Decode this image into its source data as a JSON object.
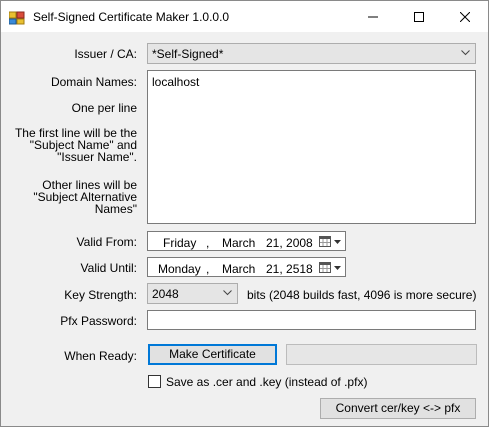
{
  "window": {
    "title": "Self-Signed Certificate Maker 1.0.0.0",
    "icon": "certificate-app-icon",
    "controls": [
      "minimize-icon",
      "maximize-icon",
      "close-icon"
    ]
  },
  "issuer": {
    "label": "Issuer / CA:",
    "value": "*Self-Signed*"
  },
  "domains": {
    "label": "Domain Names:",
    "value": "localhost",
    "note1": "One per line",
    "note2": "The first line will be the \"Subject Name\" and \"Issuer Name\".",
    "note3": "Other lines will be \"Subject Alternative Names\""
  },
  "valid_from": {
    "label": "Valid From:",
    "weekday": "Friday",
    "sep": ",",
    "month": "March",
    "day_year": "21, 2008"
  },
  "valid_until": {
    "label": "Valid Until:",
    "weekday": "Monday",
    "sep": ",",
    "month": "March",
    "day_year": "21, 2518"
  },
  "key_strength": {
    "label": "Key Strength:",
    "value": "2048",
    "hint": "bits (2048 builds fast, 4096 is more secure)"
  },
  "pfx_password": {
    "label": "Pfx Password:",
    "value": ""
  },
  "when_ready": {
    "label": "When Ready:",
    "button": "Make Certificate",
    "progress": 0
  },
  "save_as": {
    "label": "Save as .cer and .key (instead of .pfx)",
    "checked": false
  },
  "convert_button": "Convert cer/key <-> pfx"
}
